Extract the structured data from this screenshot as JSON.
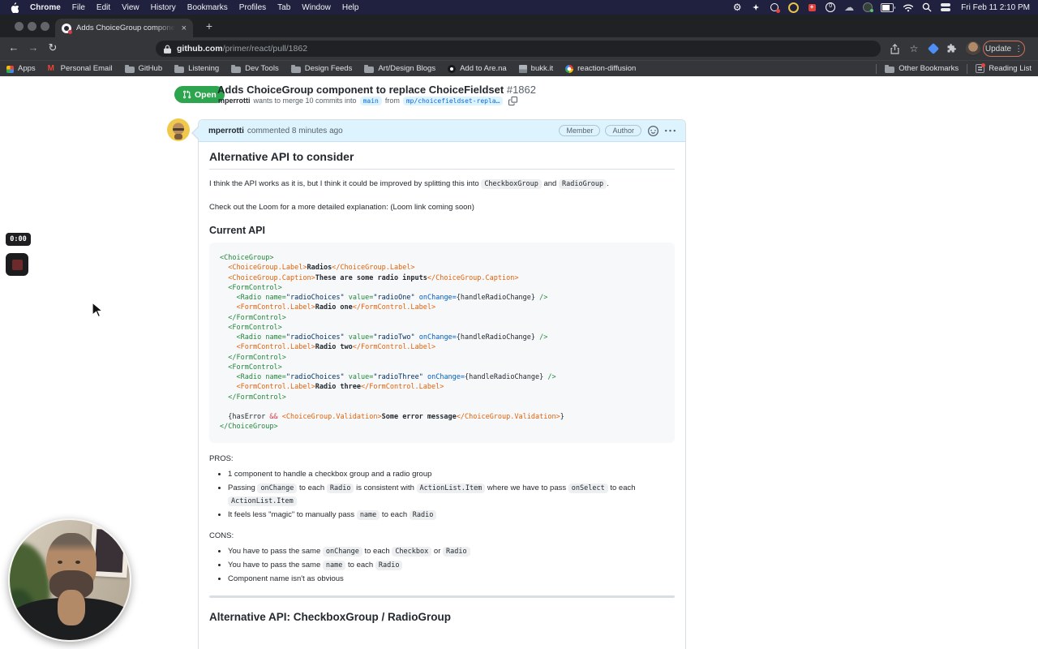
{
  "menubar": {
    "active_app": "Chrome",
    "menus": [
      "Chrome",
      "File",
      "Edit",
      "View",
      "History",
      "Bookmarks",
      "Profiles",
      "Tab",
      "Window",
      "Help"
    ],
    "status_icons": [
      {
        "name": "settings-gear-icon",
        "type": "gear"
      },
      {
        "name": "sparkle-app-icon",
        "type": "spark"
      },
      {
        "name": "camera-app-icon",
        "type": "cam"
      },
      {
        "name": "timer-app-icon",
        "type": "yellow"
      },
      {
        "name": "health-app-icon",
        "type": "redplus"
      },
      {
        "name": "zero-badge-icon",
        "type": "zero"
      },
      {
        "name": "cloud-sync-icon",
        "type": "cloud"
      },
      {
        "name": "globe-status-icon",
        "type": "globe"
      }
    ],
    "clock": "Fri Feb 11  2:10 PM"
  },
  "window": {
    "tab_title": "Adds ChoiceGroup component",
    "close_glyph": "×",
    "new_tab_glyph": "+"
  },
  "toolbar": {
    "back_glyph": "←",
    "forward_glyph": "→",
    "reload_glyph": "↻",
    "url_host": "github.com",
    "url_path": "/primer/react/pull/1862",
    "star_glyph": "☆",
    "update_label": "Update",
    "menu_glyph": "⋮"
  },
  "bookmarks": {
    "items": [
      {
        "label": "Apps",
        "icon": "grid"
      },
      {
        "label": "Personal Email",
        "icon": "gmail"
      },
      {
        "label": "GitHub",
        "icon": "folder"
      },
      {
        "label": "Listening",
        "icon": "folder"
      },
      {
        "label": "Dev Tools",
        "icon": "folder"
      },
      {
        "label": "Design Feeds",
        "icon": "folder"
      },
      {
        "label": "Art/Design Blogs",
        "icon": "folder"
      },
      {
        "label": "Add to Are.na",
        "icon": "arena"
      },
      {
        "label": "bukk.it",
        "icon": "image"
      },
      {
        "label": "reaction-diffusion",
        "icon": "google"
      }
    ],
    "other_label": "Other Bookmarks",
    "reading_label": "Reading List"
  },
  "pr": {
    "state": "Open",
    "title": "Adds ChoiceGroup component to replace ChoiceFieldset",
    "number": "#1862",
    "author": "mperrotti",
    "meta_middle": "wants to merge 10 commits into",
    "base_branch": "main",
    "from_word": "from",
    "head_branch": "mp/choicefieldset-repla…"
  },
  "comment": {
    "author": "mperrotti",
    "meta": "commented 8 minutes ago",
    "badges": [
      "Member",
      "Author"
    ],
    "heading1": "Alternative API to consider",
    "para1": [
      [
        "t",
        "I think the API works as it is, but I think it could be improved by splitting this into "
      ],
      [
        "c",
        "CheckboxGroup"
      ],
      [
        "t",
        " and "
      ],
      [
        "c",
        "RadioGroup"
      ],
      [
        "t",
        "."
      ]
    ],
    "para2": "Check out the Loom for a more detailed explanation: (Loom link coming soon)",
    "heading2": "Current API",
    "code_lines": [
      [
        [
          "g",
          "<ChoiceGroup>"
        ]
      ],
      [
        [
          "p",
          "  "
        ],
        [
          "o",
          "<ChoiceGroup.Label>"
        ],
        [
          "x",
          "Radios"
        ],
        [
          "o",
          "</ChoiceGroup.Label>"
        ]
      ],
      [
        [
          "p",
          "  "
        ],
        [
          "o",
          "<ChoiceGroup.Caption>"
        ],
        [
          "x",
          "These are some radio inputs"
        ],
        [
          "o",
          "</ChoiceGroup.Caption>"
        ]
      ],
      [
        [
          "p",
          "  "
        ],
        [
          "g",
          "<FormControl>"
        ]
      ],
      [
        [
          "p",
          "    "
        ],
        [
          "g",
          "<Radio"
        ],
        [
          "p",
          " "
        ],
        [
          "g",
          "name="
        ],
        [
          "s",
          "\"radioChoices\""
        ],
        [
          "p",
          " "
        ],
        [
          "g",
          "value="
        ],
        [
          "s",
          "\"radioOne\""
        ],
        [
          "p",
          " "
        ],
        [
          "b",
          "onChange="
        ],
        [
          "p",
          "{handleRadioChange}"
        ],
        [
          "g",
          " />"
        ]
      ],
      [
        [
          "p",
          "    "
        ],
        [
          "o",
          "<FormControl.Label>"
        ],
        [
          "x",
          "Radio one"
        ],
        [
          "o",
          "</FormControl.Label>"
        ]
      ],
      [
        [
          "p",
          "  "
        ],
        [
          "g",
          "</FormControl>"
        ]
      ],
      [
        [
          "p",
          "  "
        ],
        [
          "g",
          "<FormControl>"
        ]
      ],
      [
        [
          "p",
          "    "
        ],
        [
          "g",
          "<Radio"
        ],
        [
          "p",
          " "
        ],
        [
          "g",
          "name="
        ],
        [
          "s",
          "\"radioChoices\""
        ],
        [
          "p",
          " "
        ],
        [
          "g",
          "value="
        ],
        [
          "s",
          "\"radioTwo\""
        ],
        [
          "p",
          " "
        ],
        [
          "b",
          "onChange="
        ],
        [
          "p",
          "{handleRadioChange}"
        ],
        [
          "g",
          " />"
        ]
      ],
      [
        [
          "p",
          "    "
        ],
        [
          "o",
          "<FormControl.Label>"
        ],
        [
          "x",
          "Radio two"
        ],
        [
          "o",
          "</FormControl.Label>"
        ]
      ],
      [
        [
          "p",
          "  "
        ],
        [
          "g",
          "</FormControl>"
        ]
      ],
      [
        [
          "p",
          "  "
        ],
        [
          "g",
          "<FormControl>"
        ]
      ],
      [
        [
          "p",
          "    "
        ],
        [
          "g",
          "<Radio"
        ],
        [
          "p",
          " "
        ],
        [
          "g",
          "name="
        ],
        [
          "s",
          "\"radioChoices\""
        ],
        [
          "p",
          " "
        ],
        [
          "g",
          "value="
        ],
        [
          "s",
          "\"radioThree\""
        ],
        [
          "p",
          " "
        ],
        [
          "b",
          "onChange="
        ],
        [
          "p",
          "{handleRadioChange}"
        ],
        [
          "g",
          " />"
        ]
      ],
      [
        [
          "p",
          "    "
        ],
        [
          "o",
          "<FormControl.Label>"
        ],
        [
          "x",
          "Radio three"
        ],
        [
          "o",
          "</FormControl.Label>"
        ]
      ],
      [
        [
          "p",
          "  "
        ],
        [
          "g",
          "</FormControl>"
        ]
      ],
      [],
      [
        [
          "p",
          "  {hasError "
        ],
        [
          "r",
          "&&"
        ],
        [
          "p",
          " "
        ],
        [
          "o",
          "<ChoiceGroup.Validation>"
        ],
        [
          "x",
          "Some error message"
        ],
        [
          "o",
          "</ChoiceGroup.Validation>"
        ],
        [
          "p",
          "}"
        ]
      ],
      [
        [
          "g",
          "</ChoiceGroup>"
        ]
      ]
    ],
    "pros_label": "PROS:",
    "pros_items": [
      [
        [
          "t",
          "1 component to handle a checkbox group and a radio group"
        ]
      ],
      [
        [
          "t",
          "Passing "
        ],
        [
          "c",
          "onChange"
        ],
        [
          "t",
          " to each "
        ],
        [
          "c",
          "Radio"
        ],
        [
          "t",
          " is consistent with "
        ],
        [
          "c",
          "ActionList.Item"
        ],
        [
          "t",
          " where we have to pass "
        ],
        [
          "c",
          "onSelect"
        ],
        [
          "t",
          " to each "
        ],
        [
          "c",
          "ActionList.Item"
        ]
      ],
      [
        [
          "t",
          "It feels less \"magic\" to manually pass "
        ],
        [
          "c",
          "name"
        ],
        [
          "t",
          " to each "
        ],
        [
          "c",
          "Radio"
        ]
      ]
    ],
    "cons_label": "CONS:",
    "cons_items": [
      [
        [
          "t",
          "You have to pass the same "
        ],
        [
          "c",
          "onChange"
        ],
        [
          "t",
          " to each "
        ],
        [
          "c",
          "Checkbox"
        ],
        [
          "t",
          " or "
        ],
        [
          "c",
          "Radio"
        ]
      ],
      [
        [
          "t",
          "You have to pass the same "
        ],
        [
          "c",
          "name"
        ],
        [
          "t",
          " to each "
        ],
        [
          "c",
          "Radio"
        ]
      ],
      [
        [
          "t",
          "Component name isn't as obvious"
        ]
      ]
    ],
    "heading3": "Alternative API: CheckboxGroup / RadioGroup"
  },
  "recorder": {
    "timer": "0:00"
  },
  "colors": {
    "open_green": "#2da44e",
    "link_blue": "#0969da",
    "header_blue": "#ddf4ff",
    "menubar_navy": "#20213f"
  }
}
